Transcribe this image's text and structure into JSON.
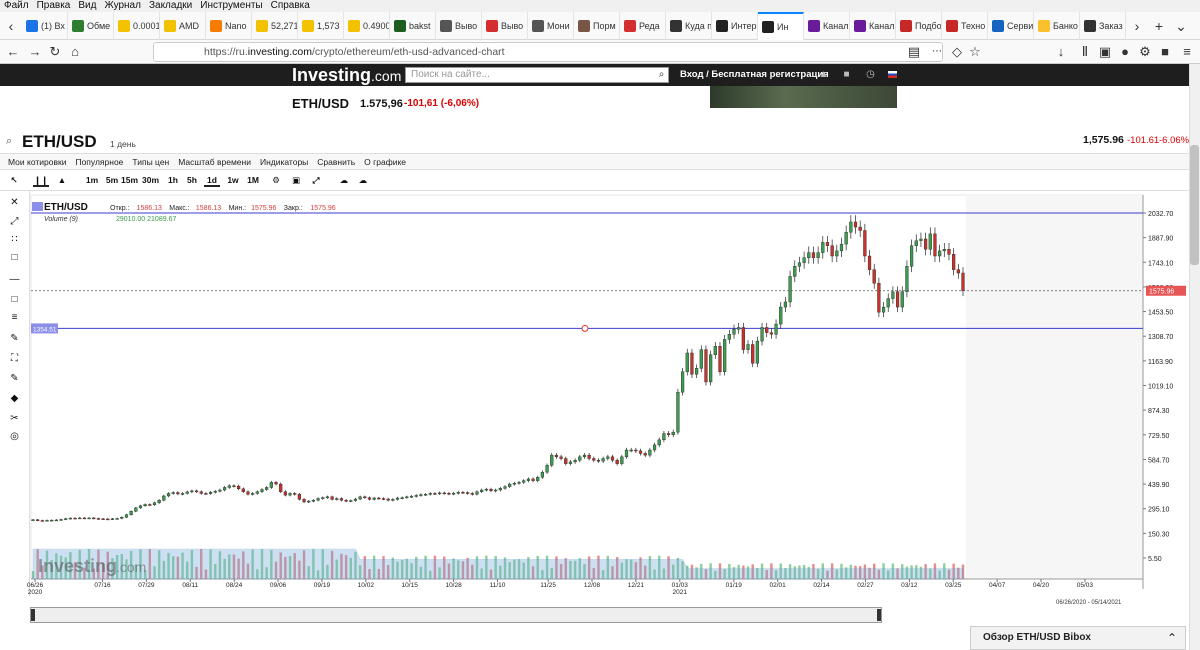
{
  "browser": {
    "menu": [
      "Файл",
      "Правка",
      "Вид",
      "Журнал",
      "Закладки",
      "Инструменты",
      "Справка"
    ],
    "tabs": [
      {
        "label": "(1) Вх",
        "color": "#1a73e8"
      },
      {
        "label": "Обме",
        "color": "#2e7d32"
      },
      {
        "label": "0.0001",
        "color": "#f2c200"
      },
      {
        "label": "AMD",
        "color": "#f2c200"
      },
      {
        "label": "Nano",
        "color": "#f57c00"
      },
      {
        "label": "52,271",
        "color": "#f2c200"
      },
      {
        "label": "1,573",
        "color": "#f2c200"
      },
      {
        "label": "0.4900",
        "color": "#f2c200"
      },
      {
        "label": "bakst",
        "color": "#1b5e20"
      },
      {
        "label": "Выво",
        "color": "#555555"
      },
      {
        "label": "Выво",
        "color": "#d32f2f"
      },
      {
        "label": "Мони",
        "color": "#555555"
      },
      {
        "label": "Порм",
        "color": "#795548"
      },
      {
        "label": "Реда",
        "color": "#d32f2f"
      },
      {
        "label": "Куда п",
        "color": "#333333"
      },
      {
        "label": "Интер",
        "color": "#222222"
      },
      {
        "label": "Ин",
        "color": "#222222",
        "active": true
      },
      {
        "label": "Канал",
        "color": "#6a1b9a"
      },
      {
        "label": "Канал",
        "color": "#6a1b9a"
      },
      {
        "label": "Подбо",
        "color": "#c62828"
      },
      {
        "label": "Техно",
        "color": "#c62828"
      },
      {
        "label": "Серви",
        "color": "#1565c0"
      },
      {
        "label": "Банко",
        "color": "#fbc02d"
      },
      {
        "label": "Заказ",
        "color": "#333333"
      }
    ],
    "url_prefix": "https://ru.",
    "url_host": "investing.com",
    "url_path": "/crypto/ethereum/eth-usd-advanced-chart"
  },
  "site": {
    "logo": "Investing",
    "logo_suffix": ".com",
    "search_placeholder": "Поиск на сайте...",
    "login": "Вход / Бесплатная регистрация"
  },
  "quote": {
    "title": "ETH/USD",
    "price": "1.575,96",
    "change": "-101,61 (-6,06%)"
  },
  "chart_header": {
    "symbol": "ETH/USD",
    "period": "1 день",
    "price": "1,575.96",
    "change": "-101.61",
    "pct": "-6.06%"
  },
  "chart_menu": [
    "Мои котировки",
    "Популярное",
    "Типы цен",
    "Масштаб времени",
    "Индикаторы",
    "Сравнить",
    "О графике"
  ],
  "timeframes": [
    "1m",
    "5m",
    "15m",
    "30m",
    "1h",
    "5h",
    "1d",
    "1w",
    "1M"
  ],
  "legend": {
    "symbol": "ETH/USD",
    "open_label": "Откр.:",
    "open": "1586.13",
    "high_label": "Макс.:",
    "high": "1586.13",
    "low_label": "Мин.:",
    "low": "1575.96",
    "close_label": "Закр.:",
    "close": "1575.96",
    "volume_label": "Volume (9)",
    "volume_values": "29010.00 21089.67",
    "hline_label": "1354.51"
  },
  "bottom": {
    "range": "06/26/2020 - 05/14/2021",
    "widget": "Обзор ETH/USD Bibox"
  },
  "colors": {
    "up": "#3d9c50",
    "down": "#c8322c",
    "line": "#3b3bd1",
    "price_tag": "#e85555"
  },
  "chart_data": {
    "type": "candlestick",
    "symbol": "ETH/USD",
    "interval": "1d",
    "y_ticks": [
      2032.7,
      1887.9,
      1743.1,
      1598.3,
      1453.5,
      1308.7,
      1163.9,
      1019.1,
      874.3,
      729.5,
      584.7,
      439.9,
      295.1,
      150.3,
      5.5
    ],
    "ylim": [
      -100,
      2100
    ],
    "last_price": 1575.96,
    "horizontal_lines": [
      2032.7,
      1354.51
    ],
    "x_tick_labels": [
      "06/26\n2020",
      "07/16",
      "07/29",
      "08/11",
      "08/24",
      "09/06",
      "09/19",
      "10/02",
      "10/15",
      "10/28",
      "11/10",
      "11/25",
      "12/08",
      "12/21",
      "01/03\n2021",
      "01/19",
      "02/01",
      "02/14",
      "02/27",
      "03/12",
      "03/25",
      "04/07",
      "04/20",
      "05/03"
    ],
    "x_range": [
      "2020-06-26",
      "2021-05-14"
    ],
    "close_series": [
      230,
      226,
      225,
      227,
      228,
      229,
      232,
      237,
      240,
      239,
      241,
      239,
      241,
      238,
      236,
      235,
      234,
      236,
      238,
      245,
      260,
      280,
      300,
      312,
      320,
      318,
      330,
      345,
      370,
      385,
      390,
      382,
      385,
      394,
      400,
      395,
      385,
      384,
      392,
      398,
      405,
      420,
      430,
      428,
      412,
      395,
      380,
      385,
      395,
      408,
      420,
      450,
      440,
      395,
      375,
      385,
      380,
      350,
      335,
      340,
      345,
      355,
      360,
      365,
      350,
      355,
      345,
      340,
      343,
      352,
      365,
      360,
      350,
      358,
      355,
      352,
      345,
      350,
      358,
      360,
      365,
      368,
      373,
      378,
      380,
      385,
      383,
      388,
      386,
      382,
      386,
      392,
      390,
      385,
      380,
      395,
      405,
      410,
      400,
      405,
      415,
      425,
      440,
      445,
      450,
      460,
      470,
      460,
      480,
      510,
      550,
      610,
      600,
      590,
      560,
      570,
      580,
      600,
      610,
      590,
      580,
      575,
      590,
      600,
      580,
      560,
      600,
      640,
      640,
      635,
      620,
      610,
      640,
      670,
      700,
      737,
      730,
      745,
      980,
      1100,
      1210,
      1085,
      1120,
      1230,
      1040,
      1200,
      1250,
      1100,
      1290,
      1320,
      1350,
      1360,
      1230,
      1260,
      1150,
      1280,
      1360,
      1330,
      1320,
      1380,
      1480,
      1510,
      1660,
      1720,
      1740,
      1770,
      1800,
      1770,
      1800,
      1860,
      1840,
      1780,
      1810,
      1850,
      1920,
      1980,
      1950,
      1930,
      1780,
      1700,
      1620,
      1450,
      1480,
      1530,
      1570,
      1480,
      1570,
      1720,
      1840,
      1870,
      1880,
      1820,
      1910,
      1780,
      1810,
      1820,
      1790,
      1700,
      1680,
      1575.96
    ],
    "volume_note": "volume histogram with moving average at bottom"
  }
}
